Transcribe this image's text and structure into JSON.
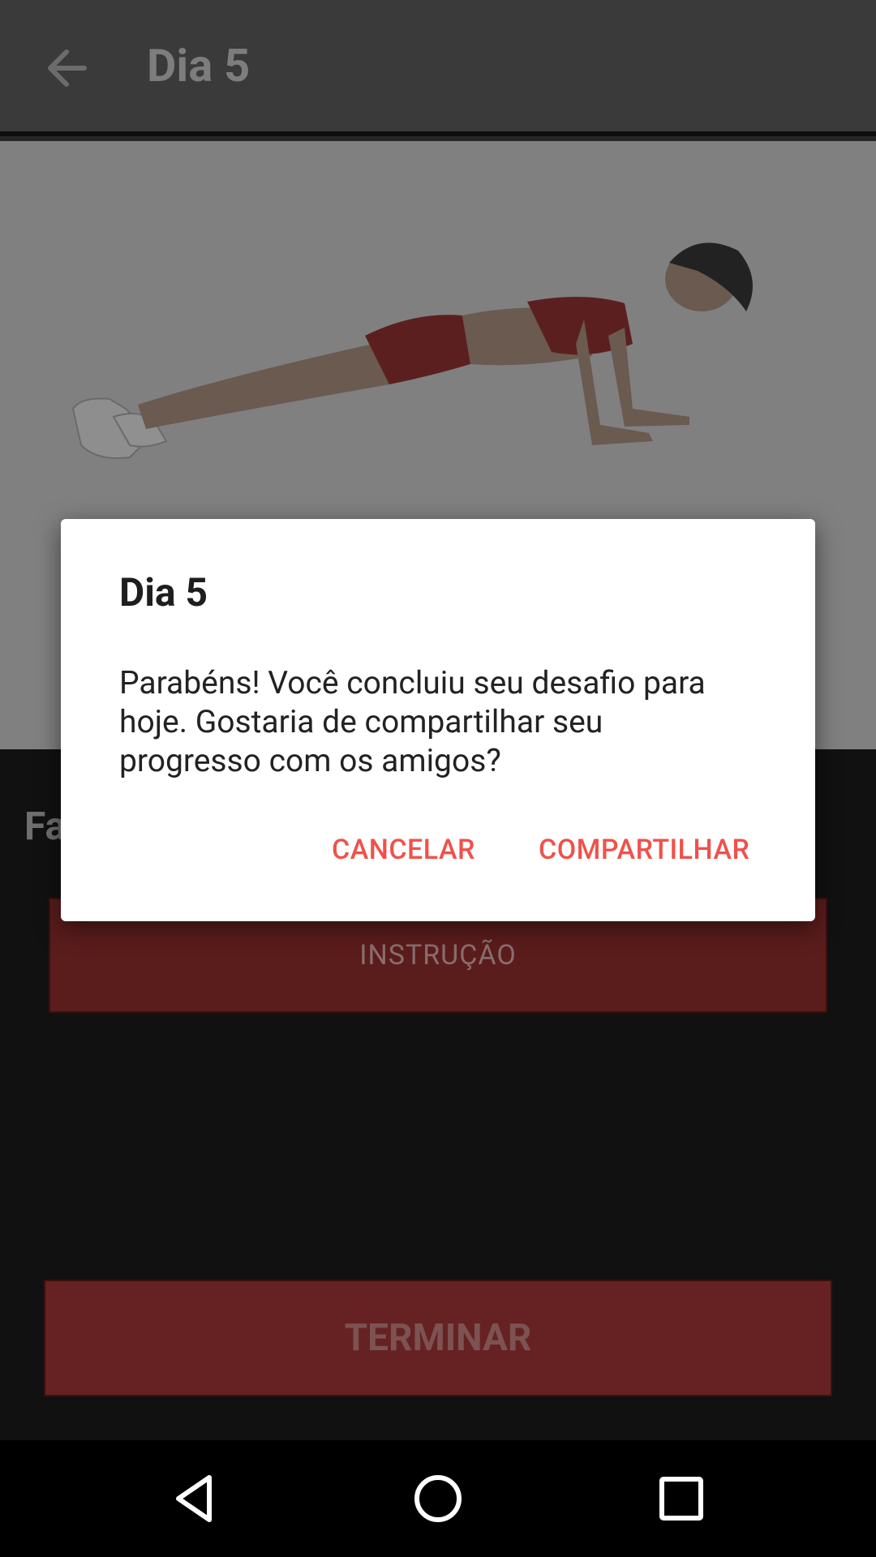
{
  "appbar": {
    "title": "Dia 5",
    "back_icon": "arrow-left-icon"
  },
  "section": {
    "title_partial": "Fa"
  },
  "buttons": {
    "instruction": "INSTRUÇÃO",
    "finish": "TERMINAR"
  },
  "dialog": {
    "title": "Dia 5",
    "message": "Parabéns! Você concluiu seu desafio para hoje. Gostaria de compartilhar seu progresso com os amigos?",
    "cancel": "CANCELAR",
    "share": "COMPARTILHAR"
  },
  "navbar": {
    "icons": [
      "back-triangle-icon",
      "home-circle-icon",
      "recents-square-icon"
    ]
  },
  "colors": {
    "accent": "#f0514b",
    "button_dim": "#662222"
  }
}
